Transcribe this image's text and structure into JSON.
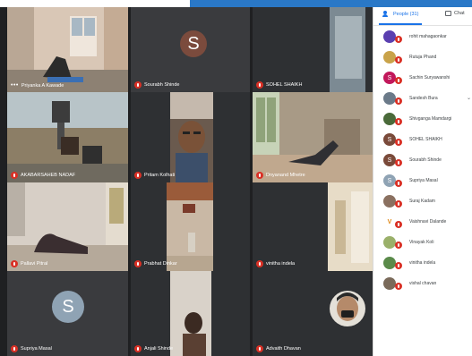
{
  "panel": {
    "people_tab": "People (31)",
    "chat_tab": "Chat"
  },
  "participants": [
    {
      "name": "rohit mahagaonkar",
      "initial": "",
      "color": "#5a3fb0"
    },
    {
      "name": "Rutuja Phand",
      "initial": "",
      "color": "#c9a34a"
    },
    {
      "name": "Sachin Suryawanshi",
      "initial": "S",
      "color": "#c2185b"
    },
    {
      "name": "Sandesh Bura",
      "initial": "",
      "color": "#6b7a89"
    },
    {
      "name": "Shivganga Mamdargi",
      "initial": "",
      "color": "#4a6a3a"
    },
    {
      "name": "SOHEL SHAIKH",
      "initial": "S",
      "color": "#7a4a3a"
    },
    {
      "name": "Sourabh Shinde",
      "initial": "S",
      "color": "#7a4a3a"
    },
    {
      "name": "Supriya Masal",
      "initial": "S",
      "color": "#8fa3b4"
    },
    {
      "name": "Suraj Kadam",
      "initial": "",
      "color": "#8a7060"
    },
    {
      "name": "Vaishnavi Dalande",
      "initial": "V",
      "color": "#ffffff"
    },
    {
      "name": "Vinayak Koli",
      "initial": "",
      "color": "#9ab06a"
    },
    {
      "name": "vinitha indela",
      "initial": "",
      "color": "#5a8a4a"
    },
    {
      "name": "vishal chavan",
      "initial": "",
      "color": "#7a6a5a"
    }
  ],
  "tiles": [
    {
      "name": "Priyanka A Kawade",
      "initial": ""
    },
    {
      "name": "Sourabh Shinde",
      "initial": "S"
    },
    {
      "name": "SOHEL SHAIKH",
      "initial": ""
    },
    {
      "name": "AKABARSAHEB NADAF",
      "initial": ""
    },
    {
      "name": "Pritam Kolhati",
      "initial": ""
    },
    {
      "name": "Dnyanand Mhetre",
      "initial": ""
    },
    {
      "name": "Pallavi Pitral",
      "initial": ""
    },
    {
      "name": "Prabhat Dinkar",
      "initial": ""
    },
    {
      "name": "vinitha indela",
      "initial": ""
    },
    {
      "name": "Supriya Masal",
      "initial": "S"
    },
    {
      "name": "Anjali Shinde",
      "initial": ""
    },
    {
      "name": "Advaith Dhavan",
      "initial": ""
    }
  ],
  "colors": {
    "mic_off": "#d93025",
    "active_speaker": "#00d1a4",
    "accent": "#1a73e8"
  }
}
